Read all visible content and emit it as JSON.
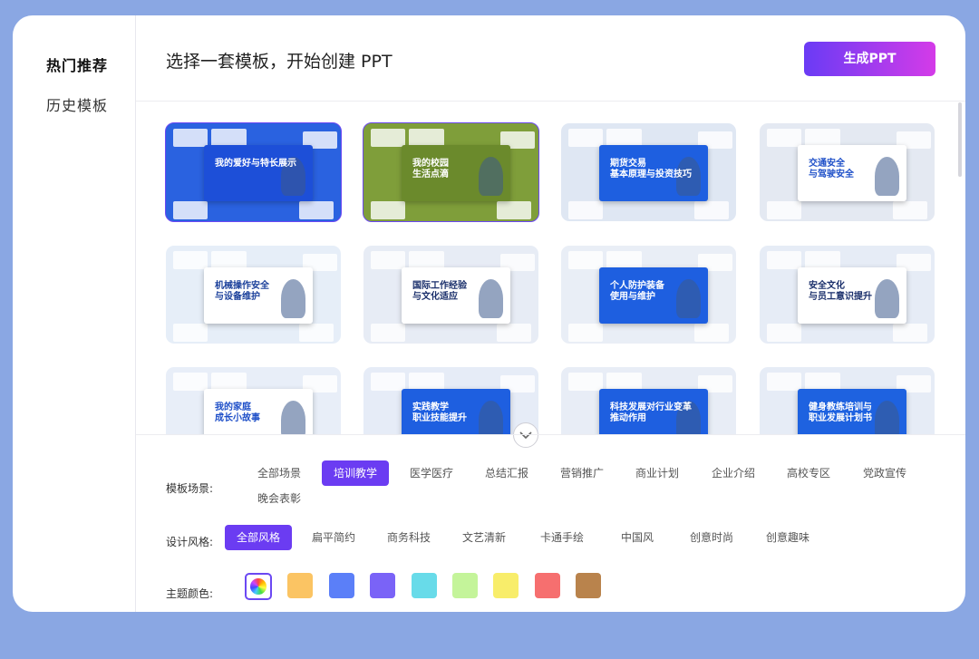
{
  "sidebar": {
    "items": [
      {
        "label": "热门推荐",
        "active": true
      },
      {
        "label": "历史模板",
        "active": false
      }
    ]
  },
  "header": {
    "title": "选择一套模板，开始创建 PPT",
    "generate_button": "生成PPT"
  },
  "templates": [
    {
      "title": "我的爱好与特长展示",
      "bg": "#2a62e0",
      "panel": "#1d4fd8",
      "text": "#ffffff",
      "selected": true
    },
    {
      "title": "我的校园\n生活点滴",
      "bg": "#7f9e3a",
      "panel": "#6b8a2c",
      "text": "#ffffff",
      "selected": true
    },
    {
      "title": "期货交易\n基本原理与投资技巧",
      "bg": "#dfe7f3",
      "panel": "#1e5fe0",
      "text": "#ffffff",
      "selected": false
    },
    {
      "title": "交通安全\n与驾驶安全",
      "bg": "#e4e9f2",
      "panel": "#ffffff",
      "text": "#1e4fc8",
      "selected": false
    },
    {
      "title": "机械操作安全\n与设备维护",
      "bg": "#e6eef8",
      "panel": "#ffffff",
      "text": "#1a3f9a",
      "selected": false
    },
    {
      "title": "国际工作经验\n与文化适应",
      "bg": "#e7ecf5",
      "panel": "#ffffff",
      "text": "#1a2f6b",
      "selected": false
    },
    {
      "title": "个人防护装备\n使用与维护",
      "bg": "#e9eef6",
      "panel": "#1e5fe0",
      "text": "#ffffff",
      "selected": false
    },
    {
      "title": "安全文化\n与员工意识提升",
      "bg": "#e6ecf6",
      "panel": "#ffffff",
      "text": "#1a2f6b",
      "selected": false
    },
    {
      "title": "我的家庭\n成长小故事",
      "bg": "#e8eef8",
      "panel": "#ffffff",
      "text": "#1e4fc8",
      "selected": false
    },
    {
      "title": "实践教学\n职业技能提升",
      "bg": "#e6ecf7",
      "panel": "#1e5fe0",
      "text": "#ffffff",
      "selected": false
    },
    {
      "title": "科技发展对行业变革\n推动作用",
      "bg": "#e8edf6",
      "panel": "#1e5fe0",
      "text": "#ffffff",
      "selected": false
    },
    {
      "title": "健身教练培训与\n职业发展计划书",
      "bg": "#e6ecf6",
      "panel": "#1e62e0",
      "text": "#ffffff",
      "selected": false
    }
  ],
  "filters": {
    "scene": {
      "label": "模板场景:",
      "options": [
        "全部场景",
        "培训教学",
        "医学医疗",
        "总结汇报",
        "营销推广",
        "商业计划",
        "企业介绍",
        "高校专区",
        "党政宣传",
        "晚会表彰"
      ],
      "selected": "培训教学"
    },
    "style": {
      "label": "设计风格:",
      "options": [
        "全部风格",
        "扁平简约",
        "商务科技",
        "文艺清新",
        "卡通手绘",
        "中国风",
        "创意时尚",
        "创意趣味"
      ],
      "selected": "全部风格"
    },
    "color": {
      "label": "主题颜色:",
      "swatches": [
        "#fbc463",
        "#5b7ff8",
        "#7a63f7",
        "#68dbe9",
        "#c4f49a",
        "#f8ed6a",
        "#f66f6f",
        "#b9834c"
      ]
    }
  },
  "icons": {
    "expand": "chevron-down-icon",
    "all_colors": "color-wheel-icon"
  }
}
